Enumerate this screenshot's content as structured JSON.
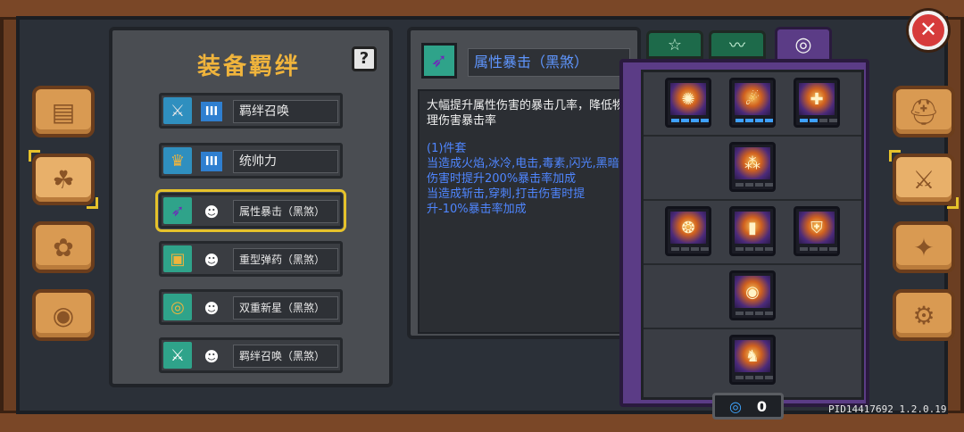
{
  "set_panel": {
    "title": "装备羁绊",
    "help_label": "?",
    "rows": [
      {
        "icon": "sword-icon",
        "mark": "III",
        "label": "羁绊召唤",
        "selected": false
      },
      {
        "icon": "trophy-icon",
        "mark": "III",
        "label": "统帅力",
        "selected": false
      },
      {
        "icon": "blade-icon",
        "mark": "☻",
        "label": "属性暴击（黑煞）",
        "selected": true
      },
      {
        "icon": "cannon-icon",
        "mark": "☻",
        "label": "重型弹药（黑煞）",
        "selected": false
      },
      {
        "icon": "spiral-icon",
        "mark": "☻",
        "label": "双重新星（黑煞）",
        "selected": false
      },
      {
        "icon": "sword-icon",
        "mark": "☻",
        "label": "羁绊召唤（黑煞）",
        "selected": false
      }
    ]
  },
  "detail": {
    "name": "属性暴击（黑煞）",
    "description": "大幅提升属性伤害的暴击几率，降低物理伤害暴击率",
    "set_header": "(1)件套",
    "bonus_1": "当造成火焰,冰冷,电击,毒素,闪光,黑暗伤害时提升200%暴击率加成",
    "bonus_2": "当造成斩击,穿刺,打击伤害时提升-10%暴击率加成"
  },
  "tree": {
    "tabs": [
      {
        "icon": "star-icon",
        "glyph": "☆"
      },
      {
        "icon": "claw-icon",
        "glyph": "〰"
      },
      {
        "icon": "spiral-icon",
        "glyph": "◎"
      }
    ],
    "counter_value": "0"
  },
  "close_label": "✕",
  "version": "PID14417692 1.2.0.19",
  "side_tabs_left": [
    "book-icon",
    "scroll-icon",
    "gems-icon",
    "wheel-icon"
  ],
  "side_tabs_right": [
    "helmet-icon",
    "sword-upgrade-icon",
    "compass-icon",
    "gear-icon"
  ]
}
